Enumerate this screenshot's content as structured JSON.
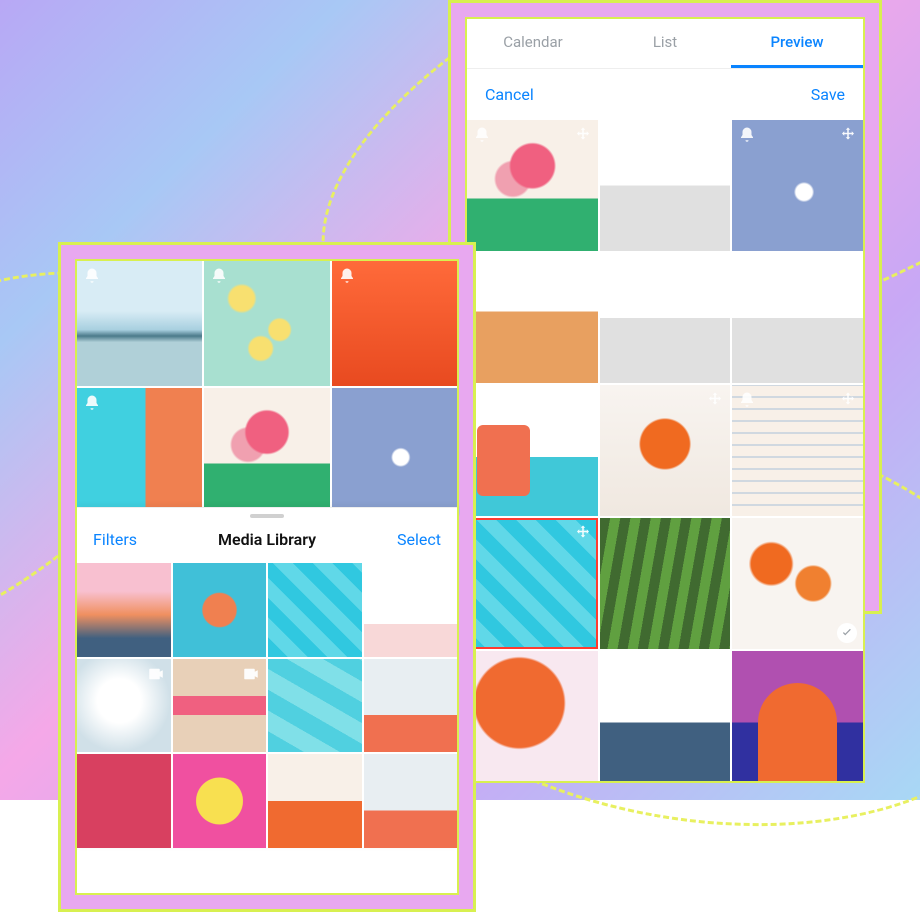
{
  "preview_panel": {
    "tabs": [
      {
        "label": "Calendar",
        "active": false
      },
      {
        "label": "List",
        "active": false
      },
      {
        "label": "Preview",
        "active": true
      }
    ],
    "cancel_label": "Cancel",
    "save_label": "Save",
    "cells": [
      {
        "name": "flowers-vase",
        "palette": "p-flowers",
        "bell": true,
        "move": true
      },
      {
        "name": "empty-slot",
        "palette": "p-tiny",
        "bell": false,
        "move": false
      },
      {
        "name": "denim-pocket",
        "palette": "p-denim",
        "bell": true,
        "move": true
      },
      {
        "name": "dining-room",
        "palette": "p-dining",
        "bell": true,
        "move": true
      },
      {
        "name": "spacer",
        "palette": "p-tiny",
        "bell": false,
        "move": false
      },
      {
        "name": "spacer2",
        "palette": "p-tiny",
        "bell": false,
        "move": false
      },
      {
        "name": "pool-chair",
        "palette": "p-chair2",
        "bell": false,
        "move": true
      },
      {
        "name": "spritz-glass",
        "palette": "p-spritz",
        "bell": false,
        "move": true
      },
      {
        "name": "paint-palette",
        "palette": "p-palette",
        "bell": true,
        "move": true
      },
      {
        "name": "pool-swimmer",
        "palette": "p-swim",
        "bell": false,
        "move": true,
        "selected": true
      },
      {
        "name": "palm-leaf",
        "palette": "p-leaf",
        "bell": false,
        "move": false
      },
      {
        "name": "aperol-drinks",
        "palette": "p-drinks",
        "bell": false,
        "move": false,
        "check": true
      },
      {
        "name": "orange-balloon",
        "palette": "p-balloon",
        "bell": false,
        "move": false
      },
      {
        "name": "person-walking",
        "palette": "p-walk",
        "bell": false,
        "move": false
      },
      {
        "name": "purple-arch",
        "palette": "p-arch",
        "bell": false,
        "move": false
      }
    ]
  },
  "library_panel": {
    "top_cells": [
      {
        "name": "sailboat-sunset",
        "palette": "p-sail",
        "bell": true
      },
      {
        "name": "lemons-water",
        "palette": "p-lemon",
        "bell": true
      },
      {
        "name": "orange-room",
        "palette": "p-orange-room",
        "bell": true
      },
      {
        "name": "pool-cocktail",
        "palette": "p-pool-drink",
        "bell": true
      },
      {
        "name": "flowers-vase",
        "palette": "p-flowers",
        "bell": false
      },
      {
        "name": "denim-daisies",
        "palette": "p-denim",
        "bell": false
      }
    ],
    "sheet": {
      "filters_label": "Filters",
      "title": "Media Library",
      "select_label": "Select",
      "cells": [
        {
          "name": "beach-sunset",
          "palette": "p-sunset",
          "video": false
        },
        {
          "name": "beach-flatlay",
          "palette": "p-flatlay",
          "video": false
        },
        {
          "name": "pool-swimmer",
          "palette": "p-swim",
          "video": false
        },
        {
          "name": "rose-wine",
          "palette": "p-wine",
          "video": false
        },
        {
          "name": "latte-bowl",
          "palette": "p-bowl",
          "video": true
        },
        {
          "name": "couple-art",
          "palette": "p-couple",
          "video": true
        },
        {
          "name": "pool-steps",
          "palette": "p-poolst",
          "video": false
        },
        {
          "name": "orange-chairs",
          "palette": "p-chairs",
          "video": false
        },
        {
          "name": "red-poster",
          "palette": "p-yellow",
          "video": false
        },
        {
          "name": "smiley-tee",
          "palette": "p-smiley",
          "video": false
        },
        {
          "name": "orange-armchair",
          "palette": "p-orange-chair",
          "video": false
        },
        {
          "name": "studio-chair",
          "palette": "p-chairs",
          "video": false
        }
      ]
    }
  },
  "colors": {
    "accent": "#0a84ff",
    "danger": "#ff3b30"
  }
}
